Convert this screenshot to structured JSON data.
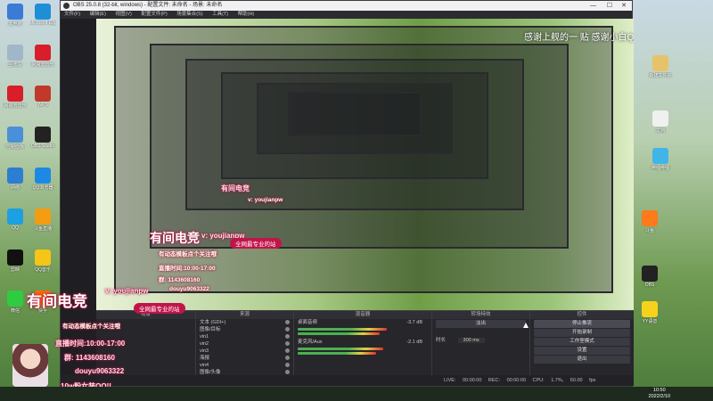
{
  "window": {
    "title": "OBS 25.0.8 (32-bit, windows) - 配置文件: 未命名 - 场景: 未命名",
    "controls": [
      "—",
      "☐",
      "✕"
    ]
  },
  "menu": [
    "文件(F)",
    "编辑(E)",
    "视图(V)",
    "配置文件(P)",
    "场景集合(S)",
    "工具(T)",
    "帮助(H)"
  ],
  "docks": {
    "scenes": {
      "header": "场景"
    },
    "sources": {
      "header": "来源",
      "items": [
        "文本 (GDI+)",
        "图像/目标",
        "vin1",
        "vin2",
        "vin3",
        "海报",
        "vin4",
        "图像/头像"
      ]
    },
    "mixer": {
      "header": "混音器",
      "channels": [
        {
          "name": "桌面音频",
          "db": "-3.7 dB"
        },
        {
          "name": "麦克风/Aux",
          "db": "-2.1 dB"
        }
      ]
    },
    "transitions": {
      "header": "转场特效",
      "type": "淡出",
      "duration_label": "时长",
      "duration": "300 ms"
    },
    "controls": {
      "header": "控件",
      "buttons": [
        "停止推流",
        "开始录制",
        "工作室模式",
        "设置",
        "退出"
      ]
    }
  },
  "status": {
    "live": "LIVE: 00:00:00",
    "rec": "REC: 00:00:00",
    "cpu": "CPU: 1.7%, 60.00 fps"
  },
  "overlay": {
    "brand": "有间电竞",
    "handle": "v: youjianpw",
    "slogan": "全网最专业的站",
    "notice": "有动态模板点个关注哦",
    "hours": "直播时间:10:00-17:00",
    "group": "群: 1143608160",
    "douyu": "douyu9063322",
    "fans": "10w粉女装QQ!!",
    "banner": "感谢上舰的一 贴  感谢小白QAQ"
  },
  "desktop_icons": [
    {
      "label": "此电脑",
      "color": "#3a7bd5"
    },
    {
      "label": "Microsoft Edge",
      "color": "#1e8fd6"
    },
    {
      "label": "回收站",
      "color": "#9fb7c9"
    },
    {
      "label": "网易云音乐",
      "color": "#d81e2a"
    },
    {
      "label": "网易云音乐",
      "color": "#d81e2a"
    },
    {
      "label": "WPS",
      "color": "#c0392b"
    },
    {
      "label": "控制面板",
      "color": "#4a90d9"
    },
    {
      "label": "OBS Studio",
      "color": "#222222"
    },
    {
      "label": "网络",
      "color": "#2d7dd2"
    },
    {
      "label": "QQ浏览器",
      "color": "#1e88e5"
    },
    {
      "label": "QQ",
      "color": "#1ba0e2"
    },
    {
      "label": "斗鱼直播",
      "color": "#f39c12"
    },
    {
      "label": "剪映",
      "color": "#111111"
    },
    {
      "label": "QQ音乐",
      "color": "#f5c518"
    },
    {
      "label": "微信",
      "color": "#2ecc40"
    },
    {
      "label": "快手",
      "color": "#ff6a00"
    }
  ],
  "right_icons": [
    {
      "label": "新建文件夹",
      "color": "#e6c36a"
    },
    {
      "label": "文档",
      "color": "#f0f0f0"
    },
    {
      "label": "哔哩哔哩",
      "color": "#40b6e8"
    },
    {
      "label": "斗鱼",
      "color": "#ff7a1a"
    },
    {
      "label": "OBS",
      "color": "#222222"
    },
    {
      "label": "YY语音",
      "color": "#f7d21c"
    }
  ],
  "clock": {
    "time": "10:50",
    "date": "2022/2/10"
  }
}
